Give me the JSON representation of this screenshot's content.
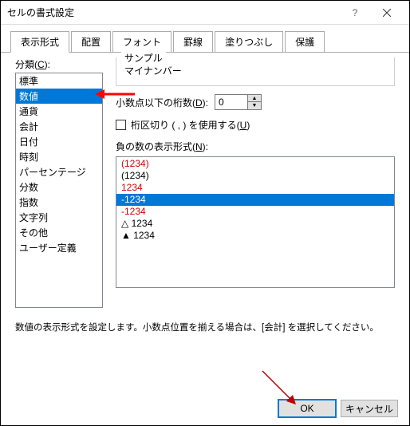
{
  "window": {
    "title": "セルの書式設定"
  },
  "tabs": [
    "表示形式",
    "配置",
    "フォント",
    "罫線",
    "塗りつぶし",
    "保護"
  ],
  "catLabel": "分類(C):",
  "categories": [
    "標準",
    "数値",
    "通貨",
    "会計",
    "日付",
    "時刻",
    "パーセンテージ",
    "分数",
    "指数",
    "文字列",
    "その他",
    "ユーザー定義"
  ],
  "selectedCategory": 1,
  "sample": {
    "label": "サンプル",
    "value": "マイナンバー"
  },
  "decimals": {
    "label": "小数点以下の桁数(D):",
    "value": "0"
  },
  "separator": {
    "label": "桁区切り ( , ) を使用する(U)"
  },
  "negLabel": "負の数の表示形式(N):",
  "negFormats": [
    {
      "text": "(1234)",
      "red": true
    },
    {
      "text": "(1234)",
      "red": false
    },
    {
      "text": "1234",
      "red": true
    },
    {
      "text": "-1234",
      "red": false,
      "selected": true
    },
    {
      "text": "-1234",
      "red": true
    },
    {
      "text": "△ 1234",
      "red": false
    },
    {
      "text": "▲ 1234",
      "red": false
    }
  ],
  "description": "数値の表示形式を設定します。小数点位置を揃える場合は、[会計] を選択してください。",
  "buttons": {
    "ok": "OK",
    "cancel": "キャンセル"
  }
}
